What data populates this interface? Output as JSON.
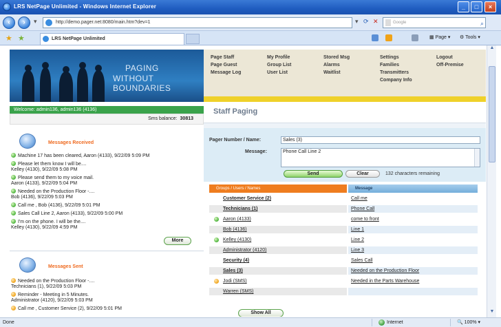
{
  "window": {
    "title": "LRS NetPage Unlimited - Windows Internet Explorer",
    "url": "http://demo.pager.net:8080/main.htm?dev=1",
    "search_placeholder": "Google",
    "tab_label": "LRS NetPage Unlimited",
    "commands": {
      "page": "Page",
      "tools": "Tools"
    }
  },
  "banner": {
    "line1": "PAGING",
    "line2": "WITHOUT BOUNDARIES"
  },
  "nav": {
    "col1": [
      "Page Staff",
      "Page Guest",
      "Message Log"
    ],
    "col2": [
      "My Profile",
      "Group List",
      "User List"
    ],
    "col3": [
      "Stored Msg",
      "Alarms",
      "Waitlist"
    ],
    "col4": [
      "Settings",
      "Families",
      "Transmitters",
      "Company Info"
    ],
    "col5": [
      "Logout",
      "Off-Premise"
    ]
  },
  "welcome": "Welcome: admin136, admin136 (4136)",
  "sms_balance": {
    "label": "Sms balance:",
    "value": "30813"
  },
  "received": {
    "title": "Messages Received",
    "items": [
      {
        "text": "Machine 17 has been cleared, Aaron (4133), 9/22/09 5:09 PM",
        "line2": ""
      },
      {
        "text": "Please let them know I will be....",
        "line2": "Kelley (4130), 9/22/09 5:08 PM"
      },
      {
        "text": "Please send them to my voice mail.",
        "line2": "Aaron (4133), 9/22/09 5:04 PM"
      },
      {
        "text": "Needed on the Production Floor -....",
        "line2": "Bob (4136), 9/22/09 5:03 PM"
      },
      {
        "text": "Call me , Bob (4136), 9/22/09 5:01 PM",
        "line2": ""
      },
      {
        "text": "Sales Call Line 2, Aaron (4133), 9/22/09 5:00 PM",
        "line2": ""
      },
      {
        "text": "I'm on the phone. I will be the....",
        "line2": "Kelley (4130), 9/22/09 4:59 PM"
      }
    ],
    "more_label": "More"
  },
  "sent": {
    "title": "Messages Sent",
    "items": [
      {
        "text": "Needed on the Production Floor -....",
        "line2": "Technicians (1), 9/22/09 5:03 PM"
      },
      {
        "text": "Reminder - Meeting in 5 Minutes.",
        "line2": "Administrator (4120), 9/22/09 5:03 PM"
      },
      {
        "text": "Call me , Customer Service (2), 9/22/09 5:01 PM",
        "line2": ""
      }
    ]
  },
  "staff_paging": {
    "title": "Staff Paging",
    "pager_label": "Pager Number / Name:",
    "pager_value": "Sales (3)",
    "message_label": "Message:",
    "message_value": "Phone Call Line 2",
    "send_label": "Send",
    "clear_label": "Clear",
    "remaining": "132 characters remaining"
  },
  "list": {
    "col_left": "Groups / Users / Names",
    "col_right": "Message",
    "rows": [
      {
        "name": "Customer Service (2)",
        "msg": "Call me",
        "kind": "group",
        "status": ""
      },
      {
        "name": "Technicians (1)",
        "msg": "Phone Call",
        "kind": "group",
        "status": ""
      },
      {
        "name": "Aaron (4133)",
        "msg": "come to front",
        "kind": "user",
        "status": "green"
      },
      {
        "name": "Bob (4136)",
        "msg": "Line 1",
        "kind": "user",
        "status": "green"
      },
      {
        "name": "Kelley (4130)",
        "msg": "Line 2",
        "kind": "user",
        "status": "green"
      },
      {
        "name": "Administrator (4120)",
        "msg": "Line 3",
        "kind": "user",
        "status": "green"
      },
      {
        "name": "Security (4)",
        "msg": "Sales Call",
        "kind": "group",
        "status": ""
      },
      {
        "name": "Sales (3)",
        "msg": "Needed on the Production Floor",
        "kind": "group",
        "status": ""
      },
      {
        "name": "Jodi (SMS)",
        "msg": "Needed in the Parts Warehouse",
        "kind": "user",
        "status": "orange"
      },
      {
        "name": "Warren (SMS)",
        "msg": "",
        "kind": "user",
        "status": "orange"
      }
    ],
    "show_all_label": "Show All"
  },
  "status": {
    "left": "Done",
    "zone": "Internet",
    "zoom": "100%"
  },
  "colors": {
    "accent_orange": "#ef7d1f",
    "accent_green": "#3aa34b",
    "nav_yellow": "#efd12a"
  }
}
